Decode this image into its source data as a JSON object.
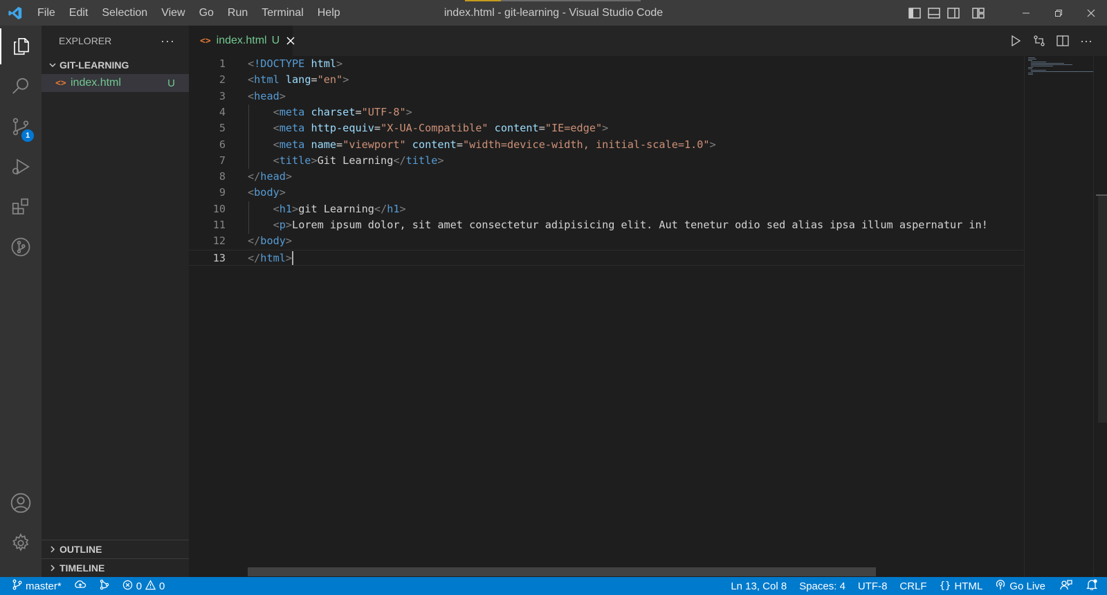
{
  "window_title": "index.html - git-learning - Visual Studio Code",
  "menu": [
    "File",
    "Edit",
    "Selection",
    "View",
    "Go",
    "Run",
    "Terminal",
    "Help"
  ],
  "activity_badge": "1",
  "sidebar": {
    "title": "EXPLORER",
    "more": "···",
    "folder": "GIT-LEARNING",
    "files": [
      {
        "name": "index.html",
        "status": "U"
      }
    ],
    "outline": "OUTLINE",
    "timeline": "TIMELINE"
  },
  "tab": {
    "name": "index.html",
    "status": "U",
    "icon": "<>"
  },
  "editor": {
    "lines": [
      {
        "n": "1",
        "tokens": [
          {
            "c": "p",
            "t": "<"
          },
          {
            "c": "tag",
            "t": "!DOCTYPE"
          },
          {
            "c": "txt",
            "t": " "
          },
          {
            "c": "attr",
            "t": "html"
          },
          {
            "c": "p",
            "t": ">"
          }
        ]
      },
      {
        "n": "2",
        "tokens": [
          {
            "c": "p",
            "t": "<"
          },
          {
            "c": "tag",
            "t": "html"
          },
          {
            "c": "txt",
            "t": " "
          },
          {
            "c": "attr",
            "t": "lang"
          },
          {
            "c": "txt",
            "t": "="
          },
          {
            "c": "str",
            "t": "\"en\""
          },
          {
            "c": "p",
            "t": ">"
          }
        ]
      },
      {
        "n": "3",
        "tokens": [
          {
            "c": "p",
            "t": "<"
          },
          {
            "c": "tag",
            "t": "head"
          },
          {
            "c": "p",
            "t": ">"
          }
        ]
      },
      {
        "n": "4",
        "tokens": [
          {
            "c": "txt",
            "t": "    "
          },
          {
            "c": "p",
            "t": "<"
          },
          {
            "c": "tag",
            "t": "meta"
          },
          {
            "c": "txt",
            "t": " "
          },
          {
            "c": "attr",
            "t": "charset"
          },
          {
            "c": "txt",
            "t": "="
          },
          {
            "c": "str",
            "t": "\"UTF-8\""
          },
          {
            "c": "p",
            "t": ">"
          }
        ]
      },
      {
        "n": "5",
        "tokens": [
          {
            "c": "txt",
            "t": "    "
          },
          {
            "c": "p",
            "t": "<"
          },
          {
            "c": "tag",
            "t": "meta"
          },
          {
            "c": "txt",
            "t": " "
          },
          {
            "c": "attr",
            "t": "http-equiv"
          },
          {
            "c": "txt",
            "t": "="
          },
          {
            "c": "str",
            "t": "\"X-UA-Compatible\""
          },
          {
            "c": "txt",
            "t": " "
          },
          {
            "c": "attr",
            "t": "content"
          },
          {
            "c": "txt",
            "t": "="
          },
          {
            "c": "str",
            "t": "\"IE=edge\""
          },
          {
            "c": "p",
            "t": ">"
          }
        ]
      },
      {
        "n": "6",
        "tokens": [
          {
            "c": "txt",
            "t": "    "
          },
          {
            "c": "p",
            "t": "<"
          },
          {
            "c": "tag",
            "t": "meta"
          },
          {
            "c": "txt",
            "t": " "
          },
          {
            "c": "attr",
            "t": "name"
          },
          {
            "c": "txt",
            "t": "="
          },
          {
            "c": "str",
            "t": "\"viewport\""
          },
          {
            "c": "txt",
            "t": " "
          },
          {
            "c": "attr",
            "t": "content"
          },
          {
            "c": "txt",
            "t": "="
          },
          {
            "c": "str",
            "t": "\"width=device-width, initial-scale=1.0\""
          },
          {
            "c": "p",
            "t": ">"
          }
        ]
      },
      {
        "n": "7",
        "tokens": [
          {
            "c": "txt",
            "t": "    "
          },
          {
            "c": "p",
            "t": "<"
          },
          {
            "c": "tag",
            "t": "title"
          },
          {
            "c": "p",
            "t": ">"
          },
          {
            "c": "txt",
            "t": "Git Learning"
          },
          {
            "c": "p",
            "t": "</"
          },
          {
            "c": "tag",
            "t": "title"
          },
          {
            "c": "p",
            "t": ">"
          }
        ]
      },
      {
        "n": "8",
        "tokens": [
          {
            "c": "p",
            "t": "</"
          },
          {
            "c": "tag",
            "t": "head"
          },
          {
            "c": "p",
            "t": ">"
          }
        ]
      },
      {
        "n": "9",
        "tokens": [
          {
            "c": "p",
            "t": "<"
          },
          {
            "c": "tag",
            "t": "body"
          },
          {
            "c": "p",
            "t": ">"
          }
        ]
      },
      {
        "n": "10",
        "tokens": [
          {
            "c": "txt",
            "t": "    "
          },
          {
            "c": "p",
            "t": "<"
          },
          {
            "c": "tag",
            "t": "h1"
          },
          {
            "c": "p",
            "t": ">"
          },
          {
            "c": "txt",
            "t": "git Learning"
          },
          {
            "c": "p",
            "t": "</"
          },
          {
            "c": "tag",
            "t": "h1"
          },
          {
            "c": "p",
            "t": ">"
          }
        ]
      },
      {
        "n": "11",
        "tokens": [
          {
            "c": "txt",
            "t": "    "
          },
          {
            "c": "p",
            "t": "<"
          },
          {
            "c": "tag",
            "t": "p"
          },
          {
            "c": "p",
            "t": ">"
          },
          {
            "c": "txt",
            "t": "Lorem ipsum dolor, sit amet consectetur adipisicing elit. Aut tenetur odio sed alias ipsa illum aspernatur in!"
          }
        ]
      },
      {
        "n": "12",
        "tokens": [
          {
            "c": "p",
            "t": "</"
          },
          {
            "c": "tag",
            "t": "body"
          },
          {
            "c": "p",
            "t": ">"
          }
        ]
      },
      {
        "n": "13",
        "tokens": [
          {
            "c": "p",
            "t": "</"
          },
          {
            "c": "tag",
            "t": "html"
          },
          {
            "c": "p",
            "t": ">"
          }
        ]
      }
    ],
    "current_line": "13"
  },
  "status": {
    "branch": "master*",
    "errors": "0",
    "warnings": "0",
    "position": "Ln 13, Col 8",
    "spaces": "Spaces: 4",
    "encoding": "UTF-8",
    "eol": "CRLF",
    "language": "HTML",
    "golive": "Go Live"
  },
  "colors": {
    "accent": "#007acc",
    "untracked": "#73c991",
    "html_icon": "#e37933",
    "tag": "#569cd6",
    "attribute": "#9cdcfe",
    "string": "#ce9178"
  },
  "icons": [
    "vscode-logo-icon",
    "files-icon",
    "search-icon",
    "source-control-icon",
    "run-debug-icon",
    "extensions-icon",
    "git-graph-icon",
    "account-icon",
    "settings-gear-icon",
    "run-icon",
    "compare-changes-icon",
    "split-editor-icon",
    "branch-icon",
    "sync-icon",
    "live-share-icon",
    "error-icon",
    "warning-icon",
    "broadcast-icon",
    "feedback-icon",
    "bell-icon"
  ]
}
